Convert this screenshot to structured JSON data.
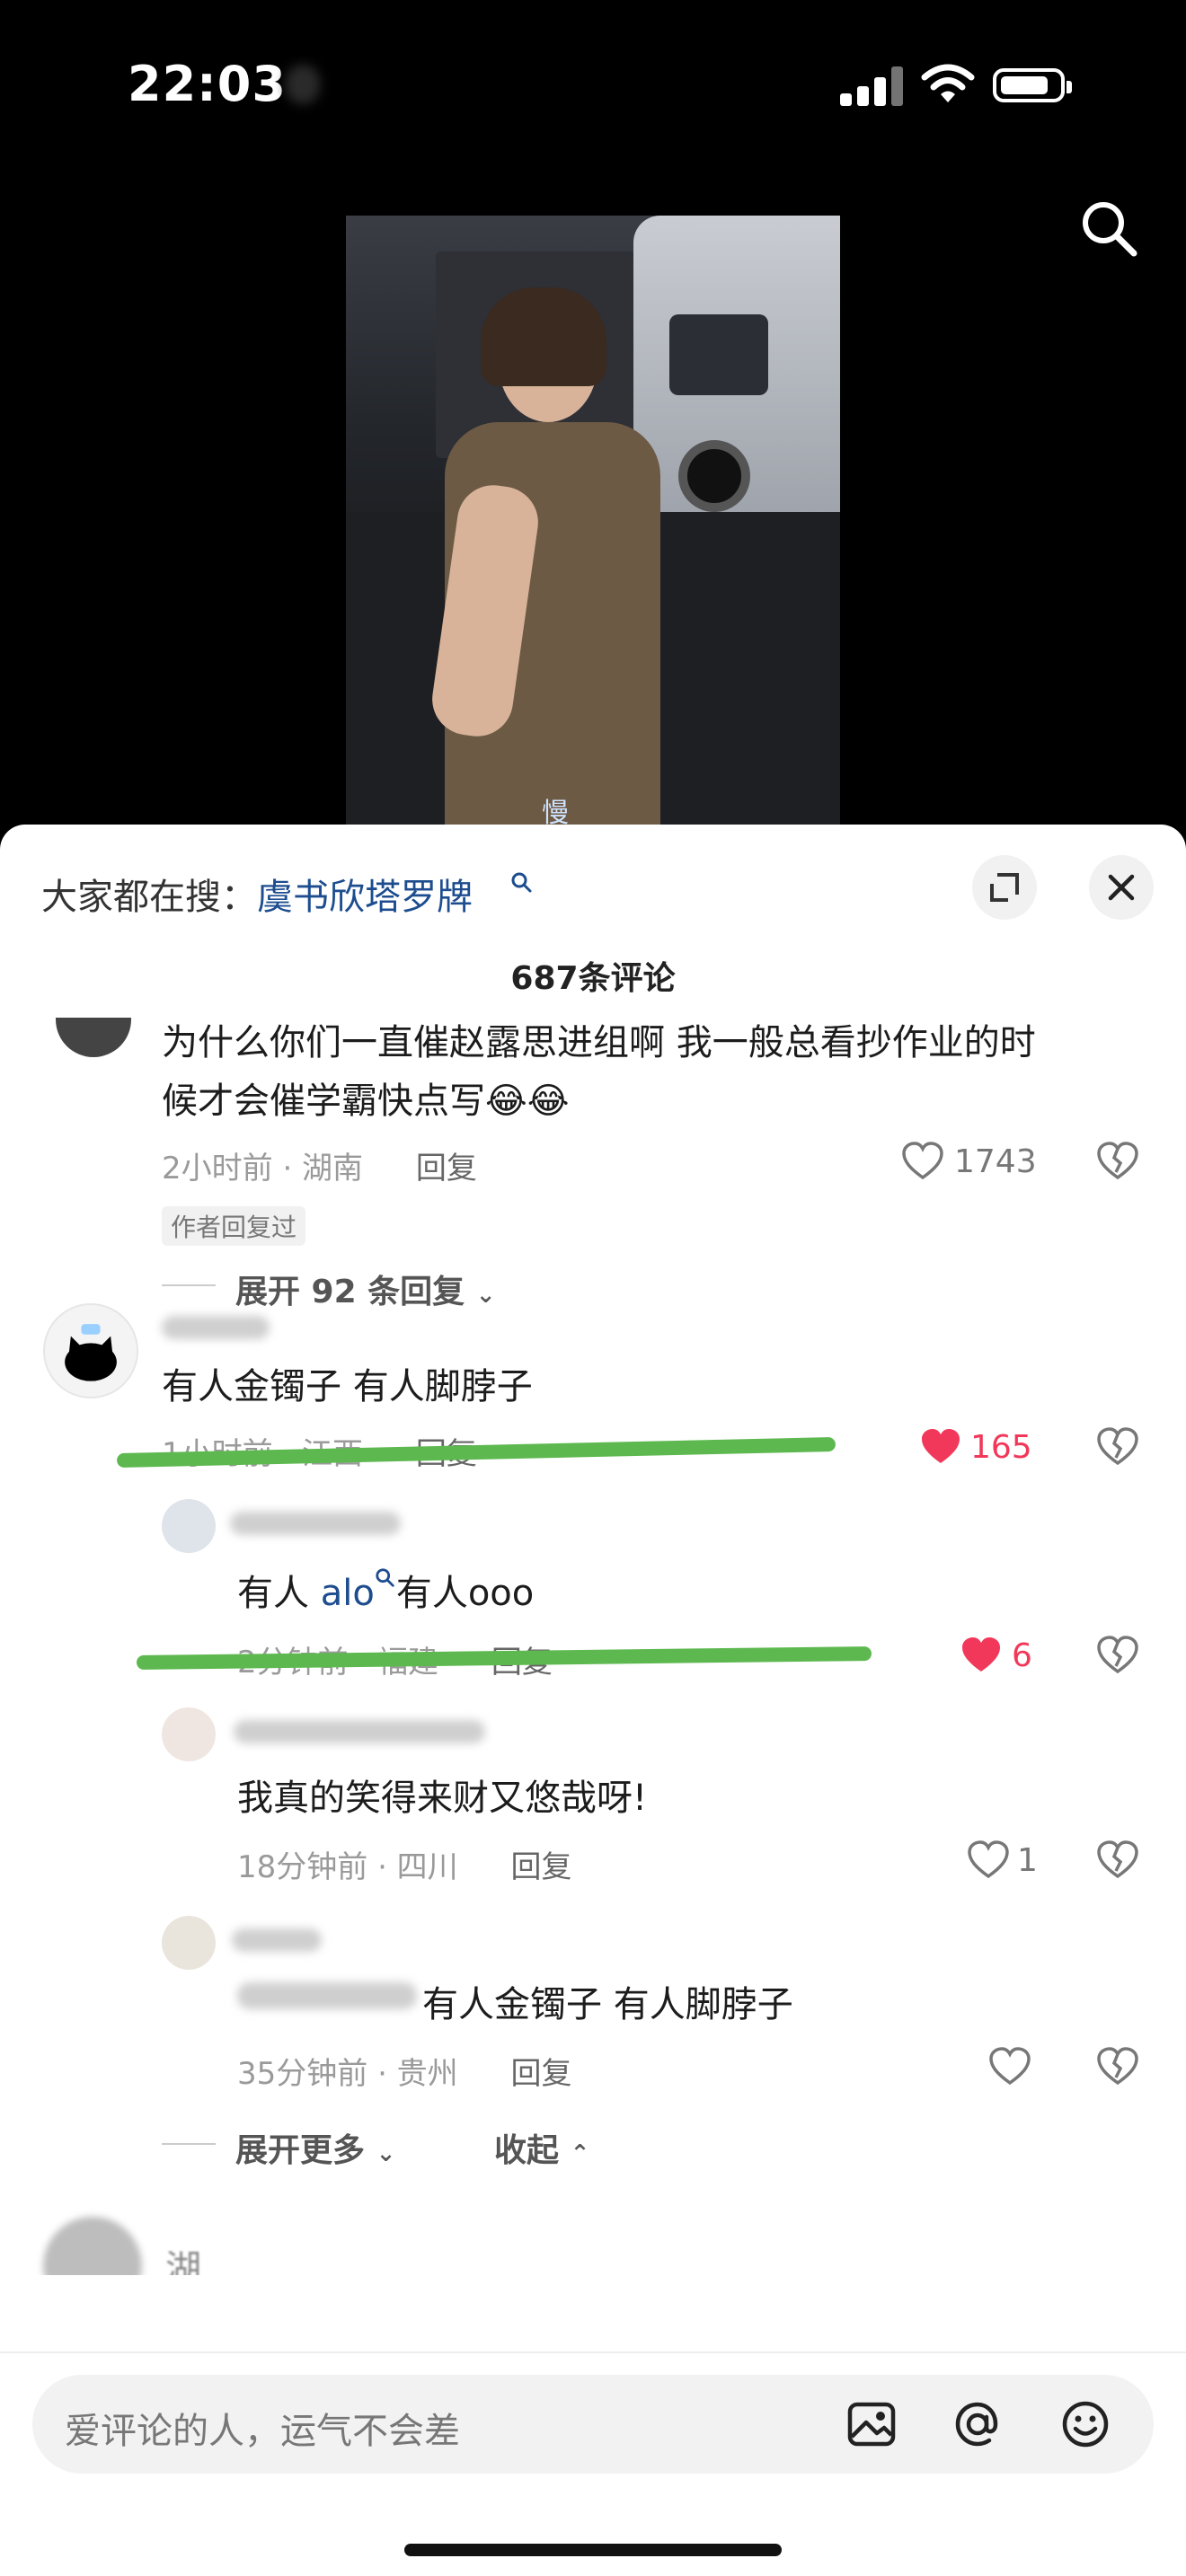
{
  "status_bar": {
    "time": "22:03"
  },
  "header": {
    "search_prefix": "大家都在搜：",
    "search_term": "虞书欣塔罗牌",
    "comment_count": "687条评论"
  },
  "video": {
    "caption_mark": "慢"
  },
  "comments": [
    {
      "text_line1": "为什么你们一直催赵露思进组啊 我一般总看抄作业的时",
      "text_line2": "候才会催学霸快点写😂😂",
      "time": "2小时前 · 湖南",
      "reply_label": "回复",
      "likes": "1743",
      "author_tag": "作者回复过",
      "expand": "展开 92 条回复"
    },
    {
      "text": "有人金镯子 有人脚脖子",
      "time": "1小时前 · 江西",
      "reply_label": "回复",
      "likes": "165",
      "replies": [
        {
          "text_prefix": "有人 ",
          "text_link": "alo",
          "text_suffix": "有人ooo",
          "time": "2分钟前 · 福建",
          "reply_label": "回复",
          "likes": "6"
        },
        {
          "text": "我真的笑得来财又悠哉呀!",
          "time": "18分钟前 · 四川",
          "reply_label": "回复",
          "likes": "1"
        },
        {
          "text": "有人金镯子 有人脚脖子",
          "time": "35分钟前 · 贵州",
          "reply_label": "回复",
          "likes": ""
        }
      ],
      "expand_more": "展开更多",
      "collapse": "收起"
    }
  ],
  "third_comment": {
    "name_partial": "湖"
  },
  "input": {
    "placeholder": "爱评论的人，运气不会差"
  },
  "icons": [
    "search-icon",
    "fullscreen-icon",
    "close-icon",
    "heart-icon",
    "broken-heart-icon",
    "image-icon",
    "at-icon",
    "emoji-icon",
    "search-small-icon"
  ],
  "colors": {
    "link": "#1d4d8f",
    "liked": "#f2385a",
    "marker": "#5db84f"
  }
}
